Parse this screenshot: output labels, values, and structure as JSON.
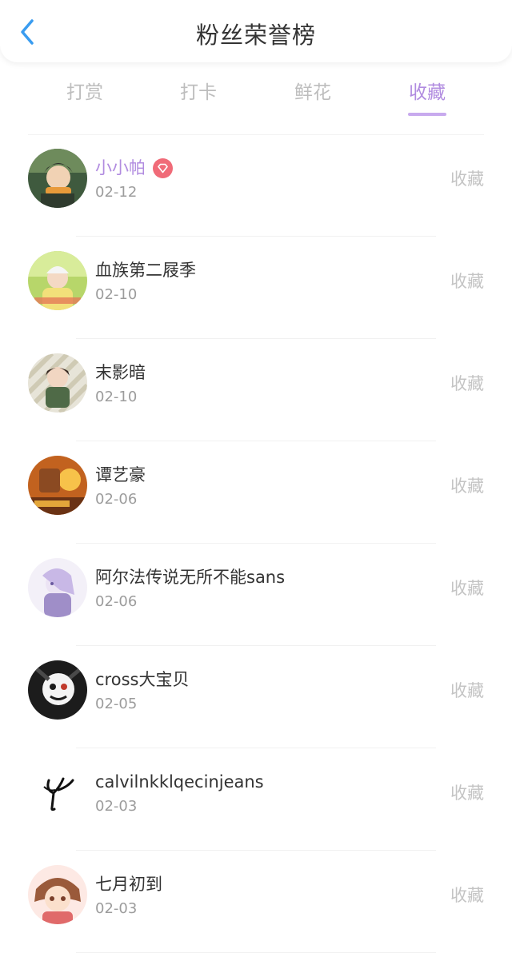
{
  "header": {
    "title": "粉丝荣誉榜"
  },
  "tabs": [
    {
      "label": "打赏",
      "active": false
    },
    {
      "label": "打卡",
      "active": false
    },
    {
      "label": "鲜花",
      "active": false
    },
    {
      "label": "收藏",
      "active": true
    }
  ],
  "colors": {
    "accent": "#b18ce0",
    "badge": "#f06b78",
    "back_arrow": "#3a9cf0"
  },
  "fans": [
    {
      "name": "小小帕",
      "date": "02-12",
      "action": "收藏",
      "highlight": true,
      "badge": "diamond-badge-icon"
    },
    {
      "name": "血族第二屐季",
      "date": "02-10",
      "action": "收藏"
    },
    {
      "name": "末影暗",
      "date": "02-10",
      "action": "收藏"
    },
    {
      "name": "谭艺豪",
      "date": "02-06",
      "action": "收藏"
    },
    {
      "name": "阿尔法传说无所不能sans",
      "date": "02-06",
      "action": "收藏"
    },
    {
      "name": "cross大宝贝",
      "date": "02-05",
      "action": "收藏"
    },
    {
      "name": "calvilnkklqecinjeans",
      "date": "02-03",
      "action": "收藏"
    },
    {
      "name": "七月初到",
      "date": "02-03",
      "action": "收藏"
    }
  ]
}
